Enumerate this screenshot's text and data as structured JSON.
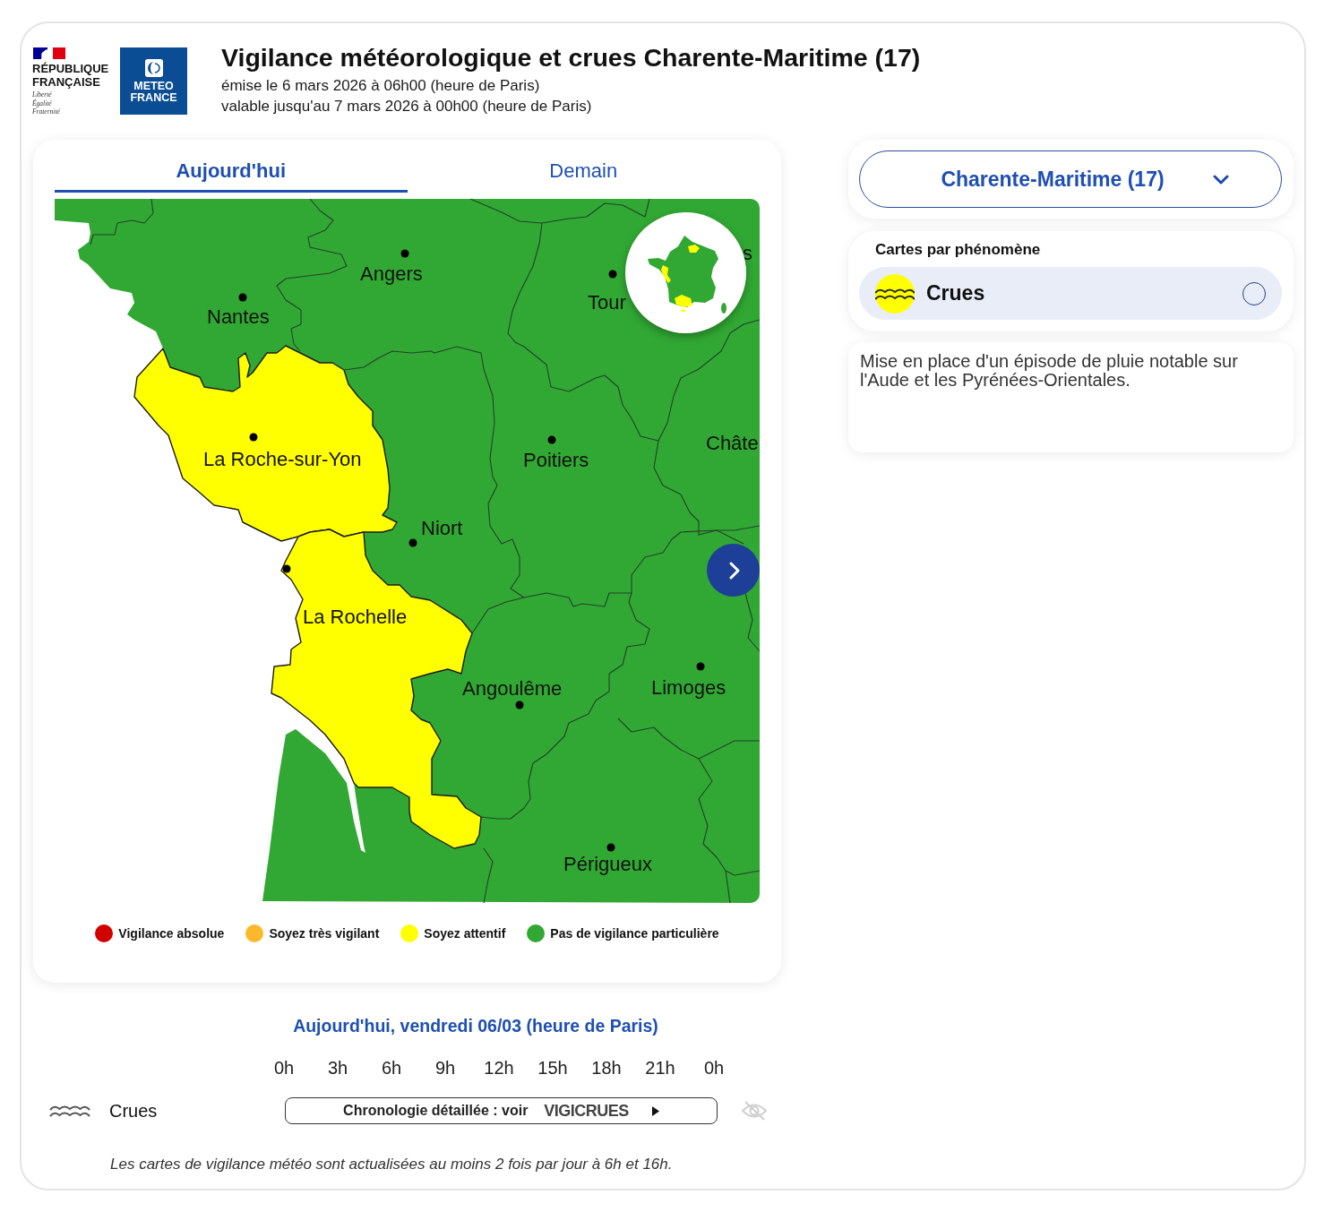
{
  "header": {
    "republic_logo": {
      "name_lines": [
        "RÉPUBLIQUE",
        "FRANÇAISE"
      ],
      "motto": [
        "Liberté",
        "Égalité",
        "Fraternité"
      ]
    },
    "brand_logo": {
      "lines": [
        "METEO",
        "FRANCE"
      ]
    },
    "title": "Vigilance météorologique et crues Charente-Maritime (17)",
    "issued": "émise le 6 mars 2026 à 06h00 (heure de Paris)",
    "valid_until": "valable jusqu'au 7 mars 2026 à 00h00 (heure de Paris)"
  },
  "tabs": [
    {
      "label": "Aujourd'hui",
      "selected": true
    },
    {
      "label": "Demain",
      "selected": false
    }
  ],
  "map": {
    "zones": [
      {
        "color": "#31a833"
      },
      {
        "color": "#ffff00"
      },
      {
        "color": "#ffff00"
      }
    ],
    "labels": [
      "Angers",
      "Tour",
      "s",
      "Nantes",
      "La Roche-sur-Yon",
      "Poitiers",
      "Châte",
      "Niort",
      "La Rochelle",
      "Angoulême",
      "Limoges",
      "Périgueux"
    ]
  },
  "legend": [
    {
      "label": "Vigilance absolue",
      "color": "#d10000"
    },
    {
      "label": "Soyez très vigilant",
      "color": "#ffb82b"
    },
    {
      "label": "Soyez attentif",
      "color": "#ffff00"
    },
    {
      "label": "Pas de vigilance particulière",
      "color": "#31a833"
    }
  ],
  "department_select": {
    "value": "Charente-Maritime (17)"
  },
  "phenomena": {
    "title": "Cartes par phénomène",
    "items": [
      {
        "label": "Crues",
        "color": "#ffff00",
        "selected": false
      }
    ]
  },
  "message": "Mise en place d'un épisode de pluie notable sur l'Aude et les Pyrénées-Orientales.",
  "timeline": {
    "title": "Aujourd'hui, vendredi 06/03 (heure de Paris)",
    "hours": [
      "0h",
      "3h",
      "6h",
      "9h",
      "12h",
      "15h",
      "18h",
      "21h",
      "0h"
    ],
    "rows": [
      {
        "label": "Crues",
        "link_text": "Chronologie détaillée : voir",
        "logo": "VIGICRUES"
      }
    ]
  },
  "note": "Les cartes de vigilance météo sont actualisées au moins 2 fois par jour à 6h et 16h."
}
